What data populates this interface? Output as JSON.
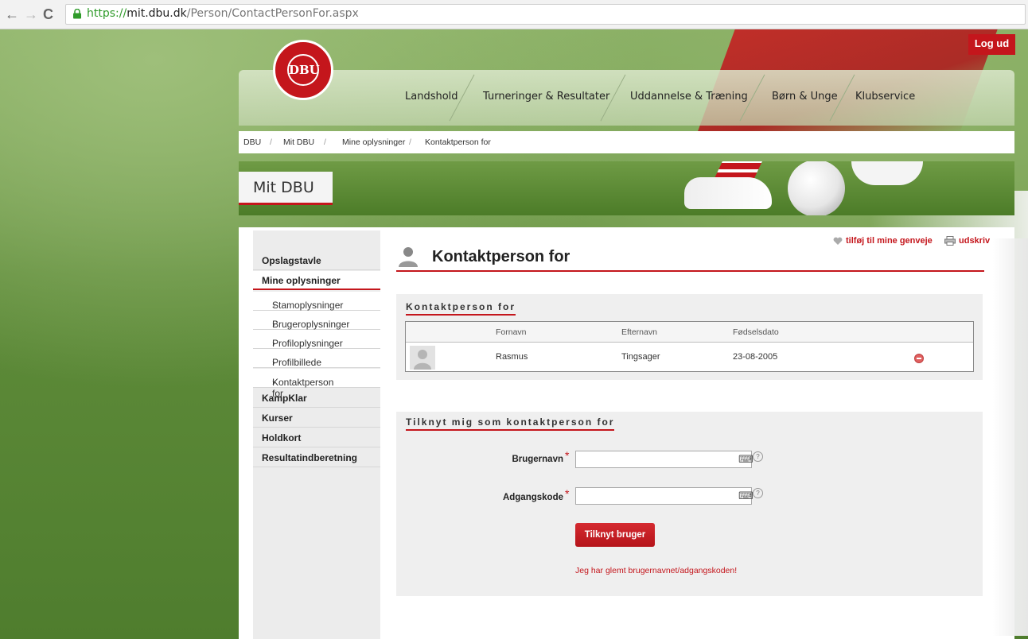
{
  "browser": {
    "url_scheme": "https://",
    "url_host": "mit.dbu.dk",
    "url_path": "/Person/ContactPersonFor.aspx",
    "back_label": "←",
    "forward_label": "→",
    "reload_label": "C"
  },
  "header": {
    "logout_label": "Log ud",
    "logo_text": "DBU",
    "nav": [
      "Landshold",
      "Turneringer & Resultater",
      "Uddannelse & Træning",
      "Børn & Unge",
      "Klubservice"
    ]
  },
  "breadcrumb": {
    "items": [
      "DBU",
      "Mit DBU",
      "Mine oplysninger",
      "Kontaktperson for"
    ],
    "separator": "/"
  },
  "banner": {
    "title": "Mit DBU"
  },
  "sidebar": {
    "items": [
      {
        "label": "Opslagstavle",
        "level": "top"
      },
      {
        "label": "Mine oplysninger",
        "level": "top"
      },
      {
        "label": "Stamoplysninger",
        "level": "sub"
      },
      {
        "label": "Brugeroplysninger",
        "level": "sub"
      },
      {
        "label": "Profiloplysninger",
        "level": "sub"
      },
      {
        "label": "Profilbillede",
        "level": "sub"
      },
      {
        "label": "Kontaktperson for",
        "level": "sub"
      },
      {
        "label": "KampKlar",
        "level": "top"
      },
      {
        "label": "Kurser",
        "level": "top"
      },
      {
        "label": "Holdkort",
        "level": "top"
      },
      {
        "label": "Resultatindberetning",
        "level": "top"
      }
    ]
  },
  "main": {
    "shortcut_label": "tilføj til mine genveje",
    "print_label": "udskriv",
    "page_title": "Kontaktperson for",
    "section1_title": "Kontaktperson for",
    "table": {
      "columns": [
        "Fornavn",
        "Efternavn",
        "Fødselsdato"
      ],
      "rows": [
        {
          "first": "Rasmus",
          "last": "Tingsager",
          "dob": "23-08-2005"
        }
      ]
    },
    "section2_title": "Tilknyt mig som kontaktperson for",
    "username_label": "Brugernavn",
    "password_label": "Adgangskode",
    "required_mark": "*",
    "help_mark": "?",
    "submit_label": "Tilknyt bruger",
    "forgot_link": "Jeg har glemt brugernavnet/adgangskoden!"
  },
  "colors": {
    "brand_red": "#c4161c",
    "field_green": "#5e8a3c"
  }
}
